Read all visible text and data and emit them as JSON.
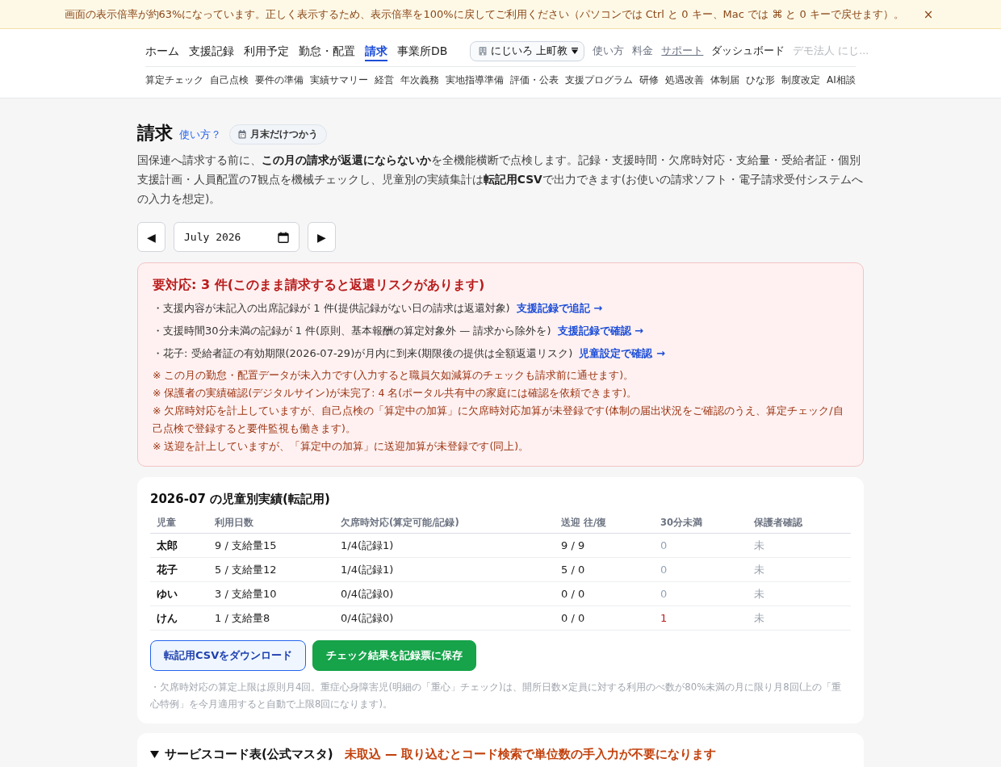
{
  "zoom_banner": {
    "text": "画面の表示倍率が約63%になっています。正しく表示するため、表示倍率を100%に戻してご利用ください（パソコンでは Ctrl と 0 キー、Mac では ⌘ と 0 キーで戻せます）。",
    "close": "×"
  },
  "header": {
    "nav": [
      {
        "label": "ホーム",
        "selected": false
      },
      {
        "label": "支援記録",
        "selected": false
      },
      {
        "label": "利用予定",
        "selected": false
      },
      {
        "label": "勤怠・配置",
        "selected": false
      },
      {
        "label": "請求",
        "selected": true
      },
      {
        "label": "事業所DB",
        "selected": false
      }
    ],
    "facility_select": {
      "value": "にじいろ 上町教"
    },
    "links": [
      {
        "label": "使い方",
        "kind": "plain"
      },
      {
        "label": "料金",
        "kind": "plain"
      },
      {
        "label": "サポート",
        "kind": "underlined"
      },
      {
        "label": "ダッシュボード",
        "kind": "strong"
      },
      {
        "label": "デモ法人 にじ...",
        "kind": "muted"
      }
    ],
    "sub_nav": [
      "算定チェック",
      "自己点検",
      "要件の準備",
      "実績サマリー",
      "経営",
      "年次義務",
      "実地指導準備",
      "評価・公表",
      "支援プログラム",
      "研修",
      "処遇改善",
      "体制届",
      "ひな形",
      "制度改定",
      "AI相談"
    ]
  },
  "page": {
    "title": "請求",
    "help_link": "使い方？",
    "mode_button": "月末だけつかう",
    "description": "国保連へ請求する前に、**この月の請求が返還にならないか**を全機能横断で点検します。記録・支援時間・欠席時対応・支給量・受給者証・個別支援計画・人員配置の7観点を機械チェックし、児童別の実績集計は**転記用CSV**で出力できます(お使いの請求ソフト・電子請求受付システムへの入力を想定)。"
  },
  "month_picker": {
    "prev": "◀",
    "value": "July 2026",
    "next": "▶"
  },
  "alert": {
    "title": "要対応: 3 件(このまま請求すると返還リスクがあります)",
    "items": [
      {
        "text": "・支援内容が未記入の出席記録が 1 件(提供記録がない日の請求は返還対象)",
        "link": "支援記録で追記 →"
      },
      {
        "text": "・支援時間30分未満の記録が 1 件(原則、基本報酬の算定対象外 — 請求から除外を)",
        "link": "支援記録で確認 →"
      },
      {
        "text": "・花子: 受給者証の有効期限(2026-07-29)が月内に到来(期限後の提供は全額返還リスク)",
        "link": "児童設定で確認 →"
      }
    ],
    "notes": [
      "※ この月の勤怠・配置データが未入力です(入力すると職員欠如減算のチェックも請求前に通せます)。",
      "※ 保護者の実績確認(デジタルサイン)が未完了: 4 名(ポータル共有中の家庭には確認を依頼できます)。",
      "※ 欠席時対応を計上していますが、自己点検の「算定中の加算」に欠席時対応加算が未登録です(体制の届出状況をご確認のうえ、算定チェック/自己点検で登録すると要件監視も働きます)。",
      "※ 送迎を計上していますが、「算定中の加算」に送迎加算が未登録です(同上)。"
    ]
  },
  "results": {
    "title": "2026-07 の児童別実績(転記用)",
    "columns": [
      "児童",
      "利用日数",
      "欠席時対応(算定可能/記録)",
      "送迎 往/復",
      "30分未満",
      "保護者確認"
    ],
    "rows": [
      {
        "child": "太郎",
        "days": "9 / 支給量15",
        "absence": "1/4(記録1)",
        "transport": "9 / 9",
        "under_30": "0",
        "under_30_alert": false,
        "guardian": "未"
      },
      {
        "child": "花子",
        "days": "5 / 支給量12",
        "absence": "1/4(記録1)",
        "transport": "5 / 0",
        "under_30": "0",
        "under_30_alert": false,
        "guardian": "未"
      },
      {
        "child": "ゆい",
        "days": "3 / 支給量10",
        "absence": "0/4(記録0)",
        "transport": "0 / 0",
        "under_30": "0",
        "under_30_alert": false,
        "guardian": "未"
      },
      {
        "child": "けん",
        "days": "1 / 支給量8",
        "absence": "0/4(記録0)",
        "transport": "0 / 0",
        "under_30": "1",
        "under_30_alert": true,
        "guardian": "未"
      }
    ],
    "buttons": [
      {
        "label": "転記用CSVをダウンロード",
        "kind": "outline"
      },
      {
        "label": "チェック結果を記録票に保存",
        "kind": "primary"
      }
    ],
    "footnote": "・欠席時対応の算定上限は原則月4回。重症心身障害児(明細の「重心」チェック)は、開所日数×定員に対する利用のべ数が80%未満の月に限り月8回(上の「重心特例」を今月適用すると自動で上限8回になります)。"
  },
  "service_codes": {
    "expanded": true,
    "title": "サービスコード表(公式マスタ)",
    "status": "未取込 — 取り込むとコード検索で単位数の手入力が不要になります"
  }
}
